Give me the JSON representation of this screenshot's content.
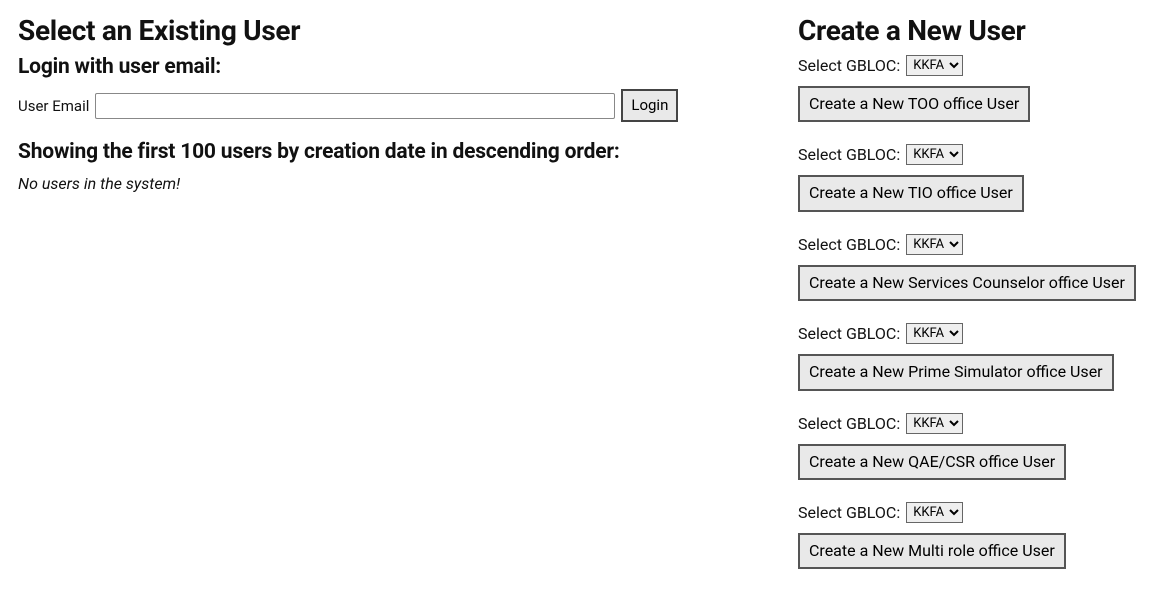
{
  "left": {
    "heading": "Select an Existing User",
    "loginHeading": "Login with user email:",
    "emailLabel": "User Email",
    "emailValue": "",
    "loginButton": "Login",
    "listHeading": "Showing the first 100 users by creation date in descending order:",
    "emptyState": "No users in the system!"
  },
  "right": {
    "heading": "Create a New User",
    "gblocLabel": "Select GBLOC:",
    "groups": [
      {
        "selected": "KKFA",
        "button": "Create a New TOO office User"
      },
      {
        "selected": "KKFA",
        "button": "Create a New TIO office User"
      },
      {
        "selected": "KKFA",
        "button": "Create a New Services Counselor office User"
      },
      {
        "selected": "KKFA",
        "button": "Create a New Prime Simulator office User"
      },
      {
        "selected": "KKFA",
        "button": "Create a New QAE/CSR office User"
      },
      {
        "selected": "KKFA",
        "button": "Create a New Multi role office User"
      }
    ]
  }
}
